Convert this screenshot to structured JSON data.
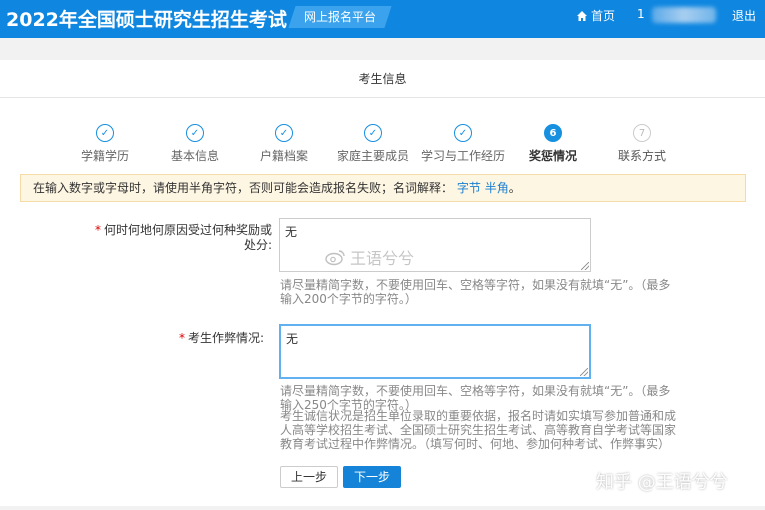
{
  "header": {
    "title": "2022年全国硕士研究生招生考试",
    "platform": "网上报名平台",
    "home": "首页",
    "user_prefix": "1",
    "logout": "退出"
  },
  "card": {
    "title": "考生信息"
  },
  "steps": [
    {
      "number": "✓",
      "label": "学籍学历",
      "state": "done"
    },
    {
      "number": "✓",
      "label": "基本信息",
      "state": "done"
    },
    {
      "number": "✓",
      "label": "户籍档案",
      "state": "done"
    },
    {
      "number": "✓",
      "label": "家庭主要成员",
      "state": "done"
    },
    {
      "number": "✓",
      "label": "学习与工作经历",
      "state": "done"
    },
    {
      "number": "6",
      "label": "奖惩情况",
      "state": "active"
    },
    {
      "number": "7",
      "label": "联系方式",
      "state": "todo"
    }
  ],
  "notice": {
    "text": "在输入数字或字母时，请使用半角字符，否则可能会造成报名失败；名词解释：",
    "link1": "字节",
    "link2": "半角",
    "end": "。"
  },
  "form": {
    "rewards": {
      "required": "*",
      "label": "何时何地何原因受过何种奖励或处分:",
      "value": "无",
      "hint": "请尽量精简字数，不要使用回车、空格等字符，如果没有就填“无”。（最多输入200个字节的字符。）"
    },
    "cheating": {
      "required": "*",
      "label": "考生作弊情况:",
      "value": "无",
      "hint1": "请尽量精简字数，不要使用回车、空格等字符，如果没有就填“无”。（最多输入250个字节的字符。）",
      "hint2": "考生诚信状况是招生单位录取的重要依据，报名时请如实填写参加普通和成人高等学校招生考试、全国硕士研究生招生考试、高等教育自学考试等国家教育考试过程中作弊情况。（填写何时、何地、参加何种考试、作弊事实）"
    }
  },
  "buttons": {
    "prev": "上一步",
    "next": "下一步"
  },
  "watermarks": {
    "middle": "王语兮兮",
    "bottom_right": "知乎 @王语兮兮"
  }
}
